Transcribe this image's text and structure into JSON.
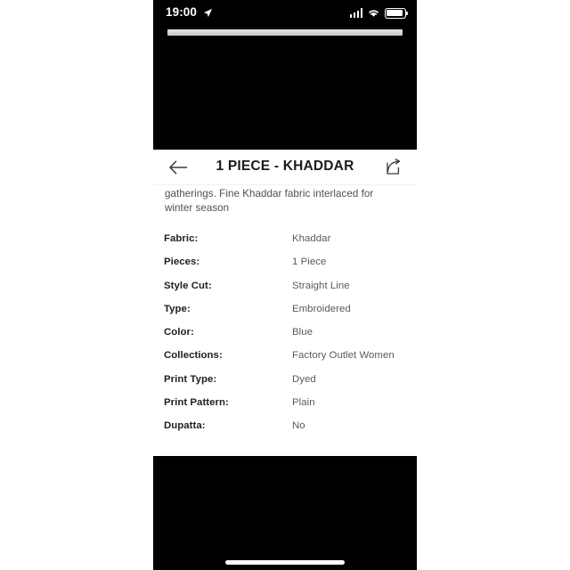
{
  "status_bar": {
    "time": "19:00",
    "location_icon": "location-arrow-icon",
    "signal_icon": "cellular-signal-icon",
    "wifi_icon": "wifi-icon",
    "battery_icon": "battery-icon"
  },
  "media": {
    "placeholder_name": "image-loading-placeholder"
  },
  "header": {
    "back_icon": "arrow-left-icon",
    "title": "1 PIECE - KHADDAR",
    "share_icon": "share-icon"
  },
  "product": {
    "description": "gatherings. Fine Khaddar fabric interlaced for winter season",
    "specs": [
      {
        "label": "Fabric:",
        "value": "Khaddar"
      },
      {
        "label": "Pieces:",
        "value": "1 Piece"
      },
      {
        "label": "Style Cut:",
        "value": "Straight Line"
      },
      {
        "label": "Type:",
        "value": "Embroidered"
      },
      {
        "label": "Color:",
        "value": "Blue"
      },
      {
        "label": "Collections:",
        "value": "Factory Outlet Women"
      },
      {
        "label": "Print Type:",
        "value": "Dyed"
      },
      {
        "label": "Print Pattern:",
        "value": "Plain"
      },
      {
        "label": "Dupatta:",
        "value": "No"
      }
    ]
  },
  "bottom": {
    "home_indicator_name": "home-indicator"
  },
  "colors": {
    "frame_background": "#000000",
    "sheet_background": "#ffffff",
    "label_text": "#1f1f1f",
    "value_text": "#5a5a5a",
    "description_text": "#4f4f4f",
    "status_text": "#ffffff"
  }
}
